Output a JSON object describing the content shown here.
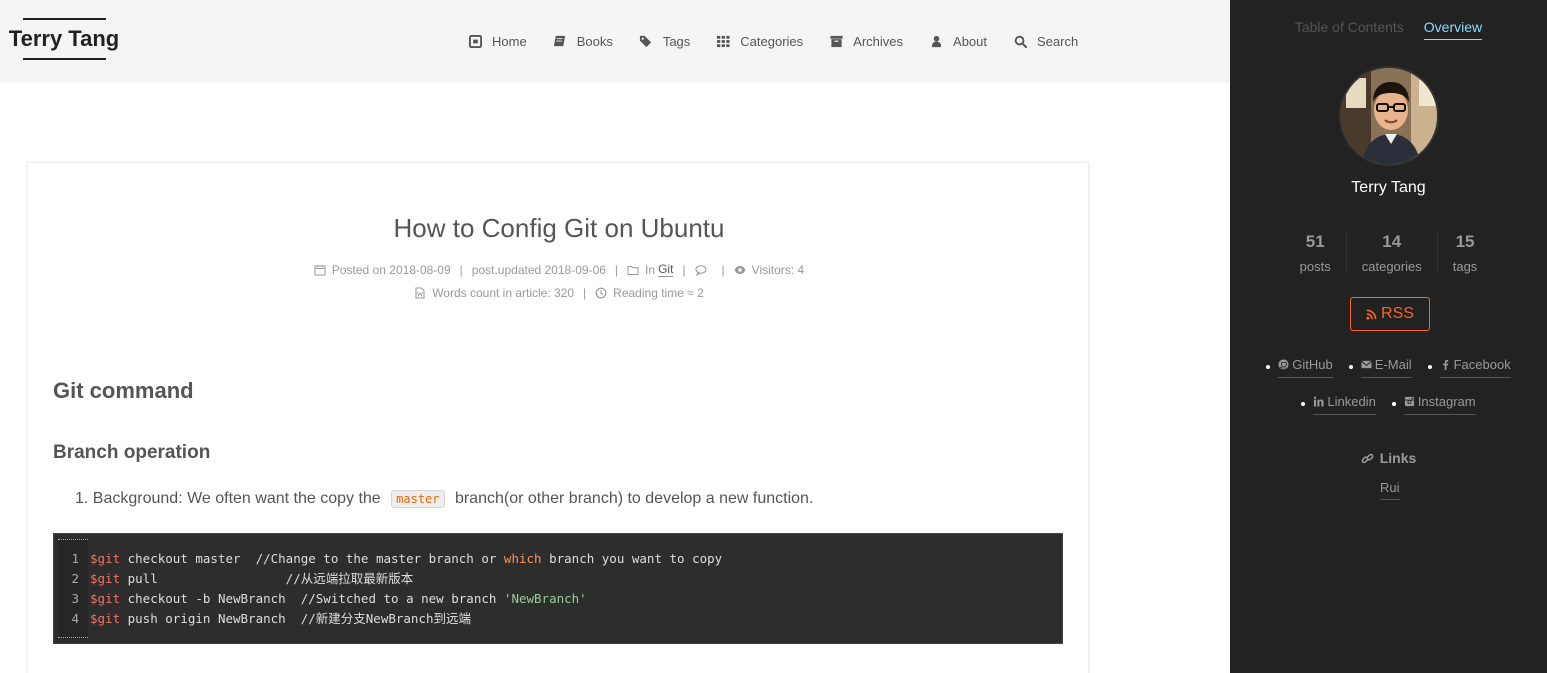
{
  "brand": {
    "title": "Terry Tang"
  },
  "nav": {
    "items": [
      {
        "label": "Home",
        "icon": "home-icon"
      },
      {
        "label": "Books",
        "icon": "book-icon"
      },
      {
        "label": "Tags",
        "icon": "tags-icon"
      },
      {
        "label": "Categories",
        "icon": "grid-icon"
      },
      {
        "label": "Archives",
        "icon": "archive-icon"
      },
      {
        "label": "About",
        "icon": "user-icon"
      },
      {
        "label": "Search",
        "icon": "search-icon"
      }
    ]
  },
  "post": {
    "title": "How to Config Git on Ubuntu",
    "meta": {
      "posted_label": "Posted on",
      "posted_date": "2018-08-09",
      "updated_label": "post.updated",
      "updated_date": "2018-09-06",
      "in_label": "In",
      "category": "Git",
      "visitors": "Visitors: 4",
      "words": "Words count in article: 320",
      "reading": "Reading time ≈ 2",
      "separator": "|"
    },
    "heading1": "Git command",
    "heading2": "Branch operation",
    "list_item": {
      "number": "1.",
      "before": "Background: We often want the copy the",
      "code": "master",
      "after": "branch(or other branch) to develop a new function."
    },
    "code": {
      "lines": [
        {
          "num": "1",
          "parts": [
            {
              "t": "var",
              "s": "$git"
            },
            {
              "t": "txt",
              "s": " checkout master  //Change to the master branch or "
            },
            {
              "t": "kw",
              "s": "which"
            },
            {
              "t": "txt",
              "s": " branch you want to copy"
            }
          ]
        },
        {
          "num": "2",
          "parts": [
            {
              "t": "var",
              "s": "$git"
            },
            {
              "t": "txt",
              "s": " pull                 //从远端拉取最新版本"
            }
          ]
        },
        {
          "num": "3",
          "parts": [
            {
              "t": "var",
              "s": "$git"
            },
            {
              "t": "txt",
              "s": " checkout -b NewBranch  //Switched to a new branch "
            },
            {
              "t": "str",
              "s": "'NewBranch'"
            }
          ]
        },
        {
          "num": "4",
          "parts": [
            {
              "t": "var",
              "s": "$git"
            },
            {
              "t": "txt",
              "s": " push origin NewBranch  //新建分支NewBranch到远端"
            }
          ]
        }
      ]
    }
  },
  "sidebar": {
    "tabs": [
      {
        "label": "Table of Contents",
        "active": false
      },
      {
        "label": "Overview",
        "active": true
      }
    ],
    "author": "Terry Tang",
    "stats": [
      {
        "num": "51",
        "label": "posts"
      },
      {
        "num": "14",
        "label": "categories"
      },
      {
        "num": "15",
        "label": "tags"
      }
    ],
    "rss": "RSS",
    "social": [
      {
        "label": "GitHub",
        "icon": "github-icon"
      },
      {
        "label": "E-Mail",
        "icon": "envelope-icon"
      },
      {
        "label": "Facebook",
        "icon": "facebook-icon"
      },
      {
        "label": "Linkedin",
        "icon": "linkedin-icon"
      },
      {
        "label": "Instagram",
        "icon": "instagram-icon"
      }
    ],
    "links_title": "Links",
    "links": [
      "Rui"
    ]
  },
  "colors": {
    "accent": "#87daff",
    "rss": "#fc6423",
    "sidebar_bg": "#222222",
    "header_bg": "#f5f5f5",
    "code_bg": "#2d2d2d"
  }
}
